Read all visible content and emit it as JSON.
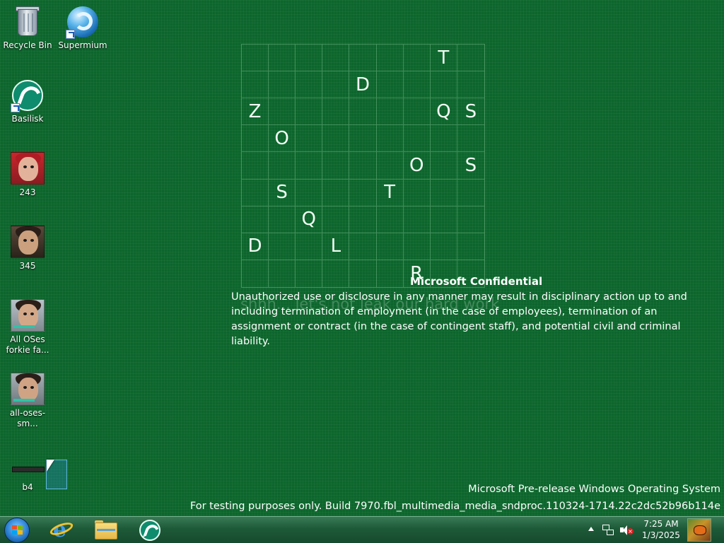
{
  "desktop_icons": [
    {
      "label": "Recycle Bin"
    },
    {
      "label": "Supermium"
    },
    {
      "label": "Basilisk"
    },
    {
      "label": "243"
    },
    {
      "label": "345"
    },
    {
      "label": "All OSes forkie fa..."
    },
    {
      "label": "all-oses-sm..."
    },
    {
      "label": "b4"
    }
  ],
  "letter_grid": [
    [
      "",
      "",
      "",
      "",
      "",
      "",
      "",
      "T",
      ""
    ],
    [
      "",
      "",
      "",
      "",
      "D",
      "",
      "",
      "",
      ""
    ],
    [
      "Z",
      "",
      "",
      "",
      "",
      "",
      "",
      "Q",
      "S"
    ],
    [
      "",
      "O",
      "",
      "",
      "",
      "",
      "",
      "",
      ""
    ],
    [
      "",
      "",
      "",
      "",
      "",
      "",
      "O",
      "",
      "S"
    ],
    [
      "",
      "S",
      "",
      "",
      "",
      "T",
      "",
      "",
      ""
    ],
    [
      "",
      "",
      "Q",
      "",
      "",
      "",
      "",
      "",
      ""
    ],
    [
      "D",
      "",
      "",
      "L",
      "",
      "",
      "",
      "",
      ""
    ],
    [
      "",
      "",
      "",
      "",
      "",
      "",
      "R",
      "",
      ""
    ]
  ],
  "overlay": {
    "ghost_text": "shhh... let's not leak our hard work",
    "confidential_title": "Microsoft Confidential",
    "confidential_body": "Unauthorized use or disclosure in any manner may result in disciplinary action up to and including termination of employment (in the case of employees), termination of an assignment or contract (in the case of contingent staff), and potential civil and criminal liability."
  },
  "watermark": {
    "line1": "Microsoft Pre-release Windows Operating System",
    "line2": "For testing purposes only. Build 7970.fbl_multimedia_media_sndproc.110324-1714.22c2dc52b96b114e"
  },
  "taskbar": {
    "pinned": [
      {
        "name": "internet-explorer-icon"
      },
      {
        "name": "file-explorer-icon"
      },
      {
        "name": "basilisk-icon"
      }
    ],
    "clock": {
      "time": "7:25 AM",
      "date": "1/3/2025"
    }
  },
  "colors": {
    "desktop_bg": "#0d6b2e",
    "taskbar_bg": "#1d5a38",
    "accent": "#2a7fd0"
  }
}
